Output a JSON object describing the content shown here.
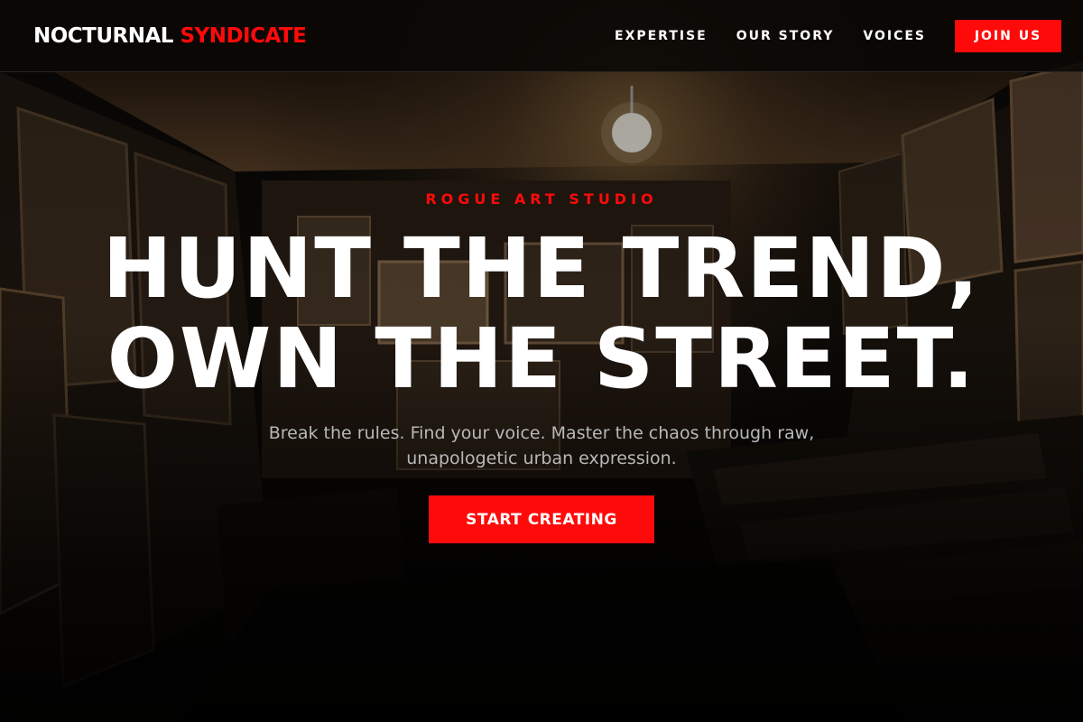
{
  "brand": {
    "name_primary": "NOCTURNAL",
    "name_accent": "SYNDICATE",
    "accent_color": "#ff0a0a"
  },
  "nav": {
    "links": [
      "EXPERTISE",
      "OUR STORY",
      "VOICES"
    ],
    "cta_label": "JOIN US"
  },
  "hero": {
    "eyebrow": "ROGUE ART STUDIO",
    "headline_line1": "HUNT THE TREND,",
    "headline_line2": "OWN THE STREET.",
    "subtitle": "Break the rules. Find your voice. Master the chaos through raw, unapologetic urban expression.",
    "cta_label": "START CREATING"
  },
  "background": {
    "description_icon": "art-storage-photo"
  }
}
